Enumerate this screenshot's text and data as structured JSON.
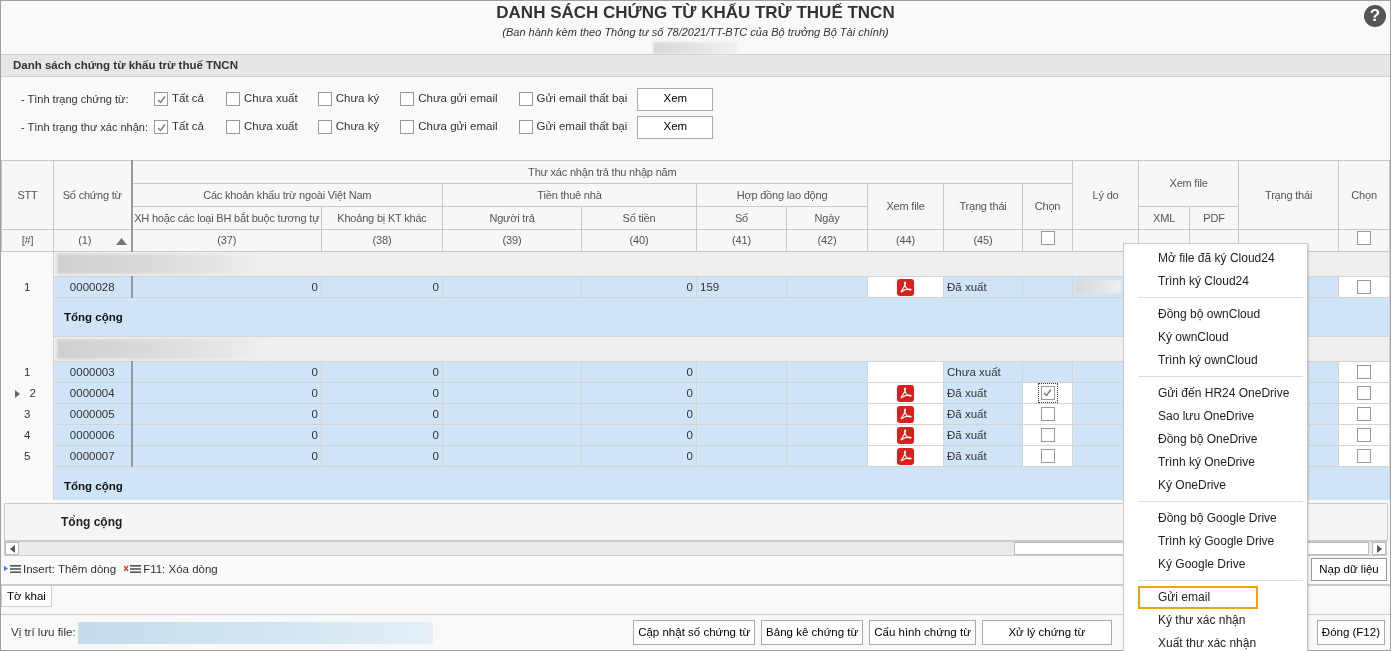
{
  "header": {
    "title": "DANH SÁCH CHỨNG TỪ KHẤU TRỪ THUẾ TNCN",
    "subtitle": "(Ban hành kèm theo Thông tư số 78/2021/TT-BTC của Bộ trưởng Bộ Tài chính)",
    "help": "?"
  },
  "section_title": "Danh sách chứng từ khấu trừ thuế TNCN",
  "filters": [
    {
      "label": "- Tình trạng chứng từ:",
      "options": [
        {
          "label": "Tất cả",
          "checked": true
        },
        {
          "label": "Chưa xuất",
          "checked": false
        },
        {
          "label": "Chưa ký",
          "checked": false
        },
        {
          "label": "Chưa gửi email",
          "checked": false
        },
        {
          "label": "Gửi email thất bại",
          "checked": false
        }
      ],
      "button": "Xem"
    },
    {
      "label": "- Tình trạng thư xác nhận:",
      "options": [
        {
          "label": "Tất cả",
          "checked": true
        },
        {
          "label": "Chưa xuất",
          "checked": false
        },
        {
          "label": "Chưa ký",
          "checked": false
        },
        {
          "label": "Chưa gửi email",
          "checked": false
        },
        {
          "label": "Gửi email thất bại",
          "checked": false
        }
      ],
      "button": "Xem"
    }
  ],
  "table": {
    "columns": [
      {
        "label": "STT",
        "index": "[#]",
        "kind": "stt"
      },
      {
        "label": "Số chứng từ",
        "index": "(1)",
        "kind": "code",
        "sort_ascending": true
      },
      {
        "label": "Thư xác nhận trả thu nhập năm",
        "children": [
          {
            "label": "Các khoản khấu trừ ngoài Việt Nam",
            "children": [
              {
                "label": "XH hoặc các loại BH bắt buộc tương tự",
                "index": "(37)",
                "kind": "number"
              },
              {
                "label": "Khoảng bị KT khác",
                "index": "(38)",
                "kind": "number"
              }
            ]
          },
          {
            "label": "Tiền thuê nhà",
            "children": [
              {
                "label": "Người trả",
                "index": "(39)",
                "kind": "text"
              },
              {
                "label": "Số tiền",
                "index": "(40)",
                "kind": "number"
              }
            ]
          },
          {
            "label": "Hợp đồng lao động",
            "children": [
              {
                "label": "Số",
                "index": "(41)",
                "kind": "text"
              },
              {
                "label": "Ngày",
                "index": "(42)",
                "kind": "text"
              }
            ]
          },
          {
            "label": "Xem file",
            "index": "(44)",
            "kind": "file"
          },
          {
            "label": "Trạng thái",
            "index": "(45)",
            "kind": "status"
          },
          {
            "label": "Chọn",
            "index_checkbox": {
              "checked": false
            },
            "kind": "check"
          }
        ]
      },
      {
        "label": "Lý do",
        "kind": "text"
      },
      {
        "label": "Xem file",
        "children": [
          {
            "label": "XML",
            "kind": "file"
          },
          {
            "label": "PDF",
            "kind": "file"
          }
        ]
      },
      {
        "label": "Trạng thái",
        "kind": "status"
      },
      {
        "label": "Chọn",
        "index_checkbox": {
          "checked": false
        },
        "kind": "check"
      }
    ],
    "groups": [
      {
        "rows": [
          {
            "stt": "1",
            "current": false,
            "cells": [
              "0000028",
              "0",
              "0",
              null,
              "0",
              "159",
              null,
              {
                "kind": "pdf"
              },
              "Đã xuất",
              null,
              {
                "kind": "redacted"
              },
              null,
              null,
              null,
              {
                "kind": "checkbox",
                "checked": false,
                "focused": false
              }
            ]
          }
        ],
        "total_label": "Tổng cộng"
      },
      {
        "rows": [
          {
            "stt": "1",
            "current": false,
            "cells": [
              "0000003",
              "0",
              "0",
              null,
              "0",
              null,
              null,
              null,
              "Chưa xuất",
              null,
              null,
              null,
              null,
              null,
              {
                "kind": "checkbox",
                "checked": false,
                "focused": false
              }
            ]
          },
          {
            "stt": "2",
            "current": true,
            "cells": [
              "0000004",
              "0",
              "0",
              null,
              "0",
              null,
              null,
              {
                "kind": "pdf"
              },
              "Đã xuất",
              {
                "kind": "checkbox",
                "checked": true,
                "focused": true
              },
              null,
              null,
              null,
              null,
              {
                "kind": "checkbox",
                "checked": false,
                "focused": false
              }
            ]
          },
          {
            "stt": "3",
            "current": false,
            "cells": [
              "0000005",
              "0",
              "0",
              null,
              "0",
              null,
              null,
              {
                "kind": "pdf"
              },
              "Đã xuất",
              {
                "kind": "checkbox",
                "checked": false,
                "focused": false
              },
              null,
              null,
              null,
              null,
              {
                "kind": "checkbox",
                "checked": false,
                "focused": false
              }
            ]
          },
          {
            "stt": "4",
            "current": false,
            "cells": [
              "0000006",
              "0",
              "0",
              null,
              "0",
              null,
              null,
              {
                "kind": "pdf"
              },
              "Đã xuất",
              {
                "kind": "checkbox",
                "checked": false,
                "focused": false
              },
              null,
              null,
              null,
              null,
              {
                "kind": "checkbox",
                "checked": false,
                "focused": false
              }
            ]
          },
          {
            "stt": "5",
            "current": false,
            "cells": [
              "0000007",
              "0",
              "0",
              null,
              "0",
              null,
              null,
              {
                "kind": "pdf"
              },
              "Đã xuất",
              {
                "kind": "checkbox",
                "checked": false,
                "focused": false
              },
              null,
              null,
              null,
              null,
              {
                "kind": "checkbox",
                "checked": false,
                "focused": false
              }
            ]
          }
        ],
        "total_label": "Tổng cộng"
      }
    ],
    "grand_total_label": "Tổng cộng"
  },
  "hints": [
    {
      "kind": "insert",
      "text": "Insert: Thêm dòng"
    },
    {
      "kind": "delete",
      "text": "F11: Xóa dòng"
    }
  ],
  "load_button": "Nạp dữ liệu",
  "tabs": [
    {
      "label": "Tờ khai",
      "selected": true
    }
  ],
  "bottom": {
    "file_label": "Vị trí lưu file:",
    "buttons": [
      "Cập nhật số chứng từ",
      "Bảng kê chứng từ",
      "Cấu hình chứng từ",
      "Xử lý chứng từ"
    ],
    "close_button": "Đóng (F12)"
  },
  "context_menu": {
    "groups": [
      [
        {
          "label": "Mở file đã ký Cloud24",
          "selected": false
        },
        {
          "label": "Trình ký Cloud24",
          "selected": false
        }
      ],
      [
        {
          "label": "Đồng bộ ownCloud",
          "selected": false
        },
        {
          "label": "Ký ownCloud",
          "selected": false
        },
        {
          "label": "Trình ký ownCloud",
          "selected": false
        }
      ],
      [
        {
          "label": "Gửi đến HR24 OneDrive",
          "selected": false
        },
        {
          "label": "Sao lưu OneDrive",
          "selected": false
        },
        {
          "label": "Đồng bộ OneDrive",
          "selected": false
        },
        {
          "label": "Trình ký OneDrive",
          "selected": false
        },
        {
          "label": "Ký OneDrive",
          "selected": false
        }
      ],
      [
        {
          "label": "Đồng bộ Google Drive",
          "selected": false
        },
        {
          "label": "Trình ký Google Drive",
          "selected": false
        },
        {
          "label": "Ký Google Drive",
          "selected": false
        }
      ],
      [
        {
          "label": "Gửi email",
          "selected": true
        },
        {
          "label": "Ký thư xác nhận",
          "selected": false
        },
        {
          "label": "Xuất thư xác nhận",
          "selected": false
        }
      ]
    ]
  }
}
